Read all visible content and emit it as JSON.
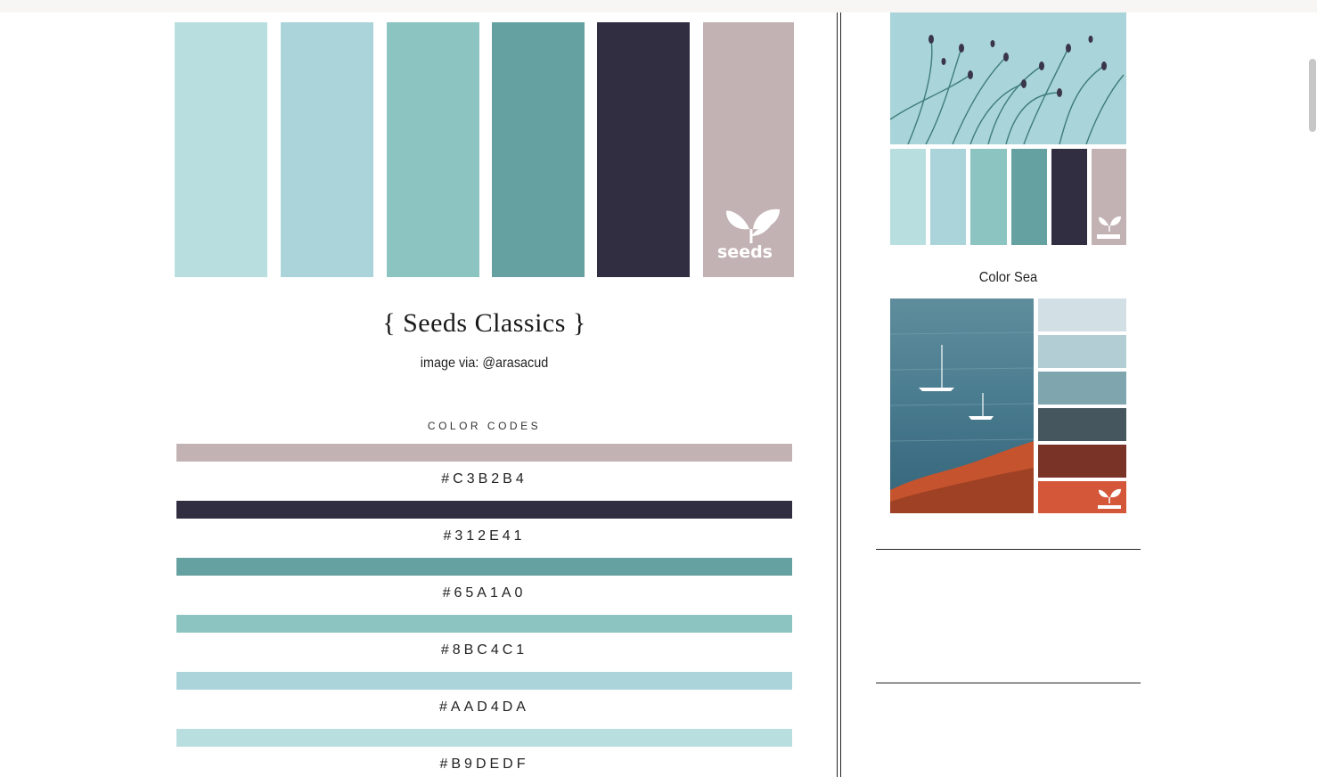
{
  "post": {
    "title": "{ Seeds Classics }",
    "image_credit": "image via: @arasacud",
    "codes_heading": "COLOR CODES"
  },
  "palette_colors": [
    "#B9DEDF",
    "#AAD4DA",
    "#8BC4C1",
    "#65A1A0",
    "#312E41",
    "#C3B2B4"
  ],
  "color_codes": [
    {
      "label": "#C3B2B4",
      "color": "#C3B2B4"
    },
    {
      "label": "#312E41",
      "color": "#312E41"
    },
    {
      "label": "#65A1A0",
      "color": "#65A1A0"
    },
    {
      "label": "#8BC4C1",
      "color": "#8BC4C1"
    },
    {
      "label": "#AAD4DA",
      "color": "#AAD4DA"
    },
    {
      "label": "#B9DEDF",
      "color": "#B9DEDF"
    }
  ],
  "logo": {
    "text": "seeds"
  },
  "sidebar": {
    "card1": {
      "swatches": [
        "#B9DEDF",
        "#AAD4DA",
        "#8BC4C1",
        "#65A1A0",
        "#312E41",
        "#C3B2B4"
      ]
    },
    "card2": {
      "title": "Color Sea",
      "swatches": [
        "#D2E0E5",
        "#B2CDD3",
        "#7FA6AF",
        "#46565E",
        "#7A3327",
        "#D5573A"
      ]
    }
  }
}
